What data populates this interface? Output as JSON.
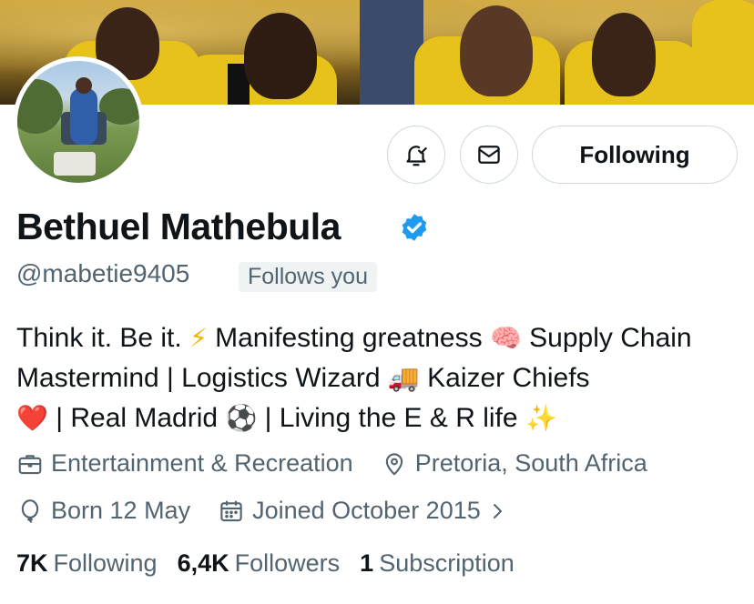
{
  "profile": {
    "name": "Bethuel Mathebula",
    "handle": "@mabetie9405",
    "follows_you_label": "Follows you",
    "bio": {
      "part1": "Think it. Be it.",
      "emoji1": "⚡",
      "part2": "Manifesting greatness",
      "emoji2": "🧠",
      "part3": "Supply Chain Mastermind | Logistics Wizard",
      "emoji3": "🚚",
      "part4": "Kaizer Chiefs",
      "emoji4": "❤️",
      "part5": "| Real Madrid",
      "emoji5": "⚽",
      "part6": "| Living the E & R life",
      "emoji6": "✨"
    },
    "category": "Entertainment & Recreation",
    "location": "Pretoria, South Africa",
    "birthday": "Born 12 May",
    "joined": "Joined October 2015"
  },
  "actions": {
    "notify_icon": "bell-check-icon",
    "message_icon": "envelope-icon",
    "following_label": "Following"
  },
  "stats": {
    "following_count": "7K",
    "following_label": "Following",
    "followers_count": "6,4K",
    "followers_label": "Followers",
    "subscription_count": "1",
    "subscription_label": "Subscription"
  },
  "colors": {
    "accent": "#1d9bf0",
    "text": "#0f1419",
    "secondary": "#536471",
    "border": "#cfd9de",
    "banner_gold": "#c9a23a"
  }
}
